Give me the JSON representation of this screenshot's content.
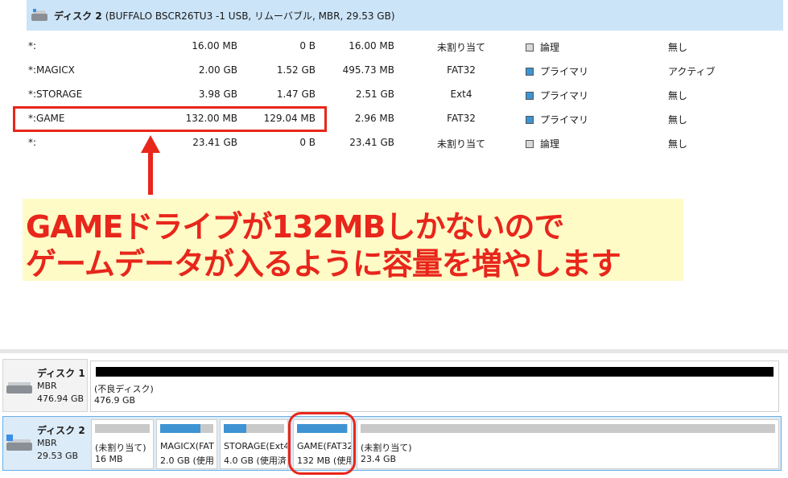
{
  "header": {
    "disk_name": "ディスク 2",
    "disk_detail": "(BUFFALO BSCR26TU3 -1 USB, リムーバブル, MBR, 29.53 GB)"
  },
  "partitions": [
    {
      "name": "*:",
      "size": "16.00 MB",
      "used": "0 B",
      "free": "16.00 MB",
      "fs": "未割り当て",
      "type": "論理",
      "type_color": "#d9d9d9",
      "status": "無し"
    },
    {
      "name": "*:MAGICX",
      "size": "2.00 GB",
      "used": "1.52 GB",
      "free": "495.73 MB",
      "fs": "FAT32",
      "type": "プライマリ",
      "type_color": "#3e93d2",
      "status": "アクティブ"
    },
    {
      "name": "*:STORAGE",
      "size": "3.98 GB",
      "used": "1.47 GB",
      "free": "2.51 GB",
      "fs": "Ext4",
      "type": "プライマリ",
      "type_color": "#3e93d2",
      "status": "無し"
    },
    {
      "name": "*:GAME",
      "size": "132.00 MB",
      "used": "129.04 MB",
      "free": "2.96 MB",
      "fs": "FAT32",
      "type": "プライマリ",
      "type_color": "#3e93d2",
      "status": "無し"
    },
    {
      "name": "*:",
      "size": "23.41 GB",
      "used": "0 B",
      "free": "23.41 GB",
      "fs": "未割り当て",
      "type": "論理",
      "type_color": "#d9d9d9",
      "status": "無し"
    }
  ],
  "annotation": {
    "line1": "GAMEドライブが132MBしかないので",
    "line2": "ゲームデータが入るように容量を増やします",
    "color": "#e8261b",
    "background": "#fefbc7"
  },
  "disk1": {
    "name": "ディスク 1",
    "type": "MBR",
    "size": "476.94 GB",
    "volume": {
      "label": "(不良ディスク)",
      "size": "476.9 GB"
    }
  },
  "disk2": {
    "name": "ディスク 2",
    "type": "MBR",
    "size": "29.53 GB",
    "volumes": [
      {
        "label": "(未割り当て)",
        "size": "16 MB",
        "used_fraction": 0
      },
      {
        "label": "MAGICX(FAT",
        "size": "2.0 GB (使用",
        "used_fraction": 0.76
      },
      {
        "label": "STORAGE(Ext4",
        "size": "4.0 GB (使用済",
        "used_fraction": 0.37
      },
      {
        "label": "GAME(FAT32",
        "size": "132 MB (使用",
        "used_fraction": 0.98
      },
      {
        "label": "(未割り当て)",
        "size": "23.4 GB",
        "used_fraction": 0
      }
    ]
  }
}
